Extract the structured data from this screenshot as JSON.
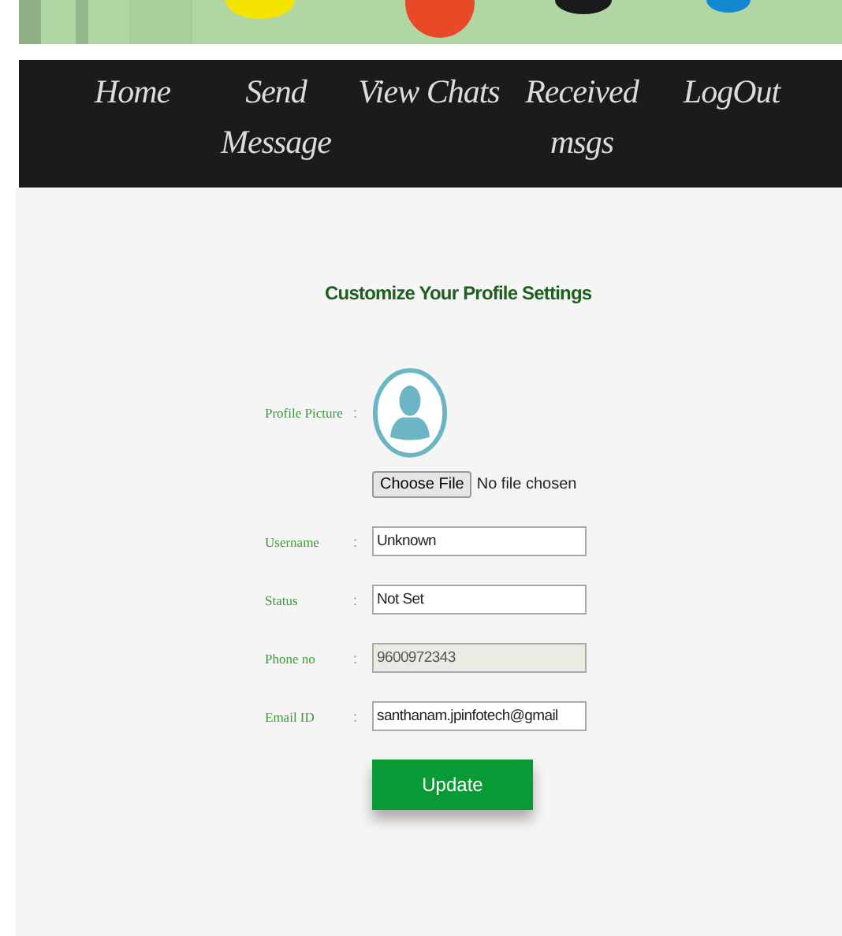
{
  "nav": [
    {
      "label": "Home"
    },
    {
      "label": "Send Message"
    },
    {
      "label": "View Chats"
    },
    {
      "label": "Received msgs"
    },
    {
      "label": "LogOut"
    }
  ],
  "title": "Customize Your Profile Settings",
  "profile_picture": {
    "label": "Profile Picture",
    "separator": ":",
    "button": "Choose File",
    "file_status": "No file chosen"
  },
  "fields": [
    {
      "label": "Username",
      "separator": ":",
      "value": "Unknown",
      "disabled": false
    },
    {
      "label": "Status",
      "separator": ":",
      "value": "Not Set",
      "disabled": false
    },
    {
      "label": "Phone no",
      "separator": ":",
      "value": "9600972343",
      "disabled": true
    },
    {
      "label": "Email ID",
      "separator": ":",
      "value": "santhanam.jpinfotech@gmail",
      "disabled": false
    }
  ],
  "submit": "Update"
}
